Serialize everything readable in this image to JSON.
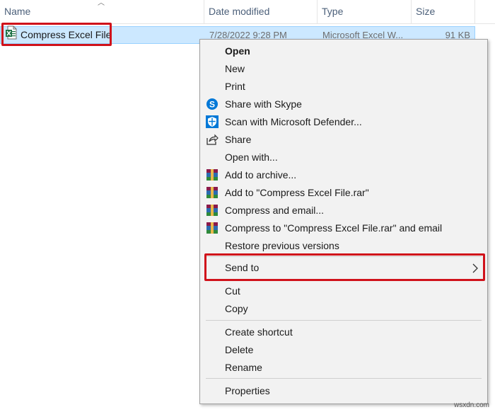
{
  "columns": {
    "name": "Name",
    "date_modified": "Date modified",
    "type": "Type",
    "size": "Size"
  },
  "file": {
    "name": "Compress Excel File",
    "date_modified": "7/28/2022 9:28 PM",
    "type": "Microsoft Excel W...",
    "size": "91 KB"
  },
  "menu": {
    "open": "Open",
    "new": "New",
    "print": "Print",
    "share_skype": "Share with Skype",
    "scan_defender": "Scan with Microsoft Defender...",
    "share": "Share",
    "open_with": "Open with...",
    "add_archive": "Add to archive...",
    "add_rar": "Add to \"Compress Excel File.rar\"",
    "compress_email": "Compress and email...",
    "compress_rar_email": "Compress to \"Compress Excel File.rar\" and email",
    "restore": "Restore previous versions",
    "send_to": "Send to",
    "cut": "Cut",
    "copy": "Copy",
    "create_shortcut": "Create shortcut",
    "delete": "Delete",
    "rename": "Rename",
    "properties": "Properties"
  },
  "icons": {
    "excel": "excel-file-icon",
    "skype": "skype-icon",
    "defender": "defender-shield-icon",
    "share": "share-icon",
    "winrar": "winrar-icon",
    "submenu": "chevron-right-icon"
  },
  "colors": {
    "selection": "#cce8ff",
    "highlight_box": "#d0121b",
    "menu_bg": "#f2f2f2",
    "skype_blue": "#0078d7",
    "excel_green": "#1e7145"
  },
  "watermark": "wsxdn.com"
}
